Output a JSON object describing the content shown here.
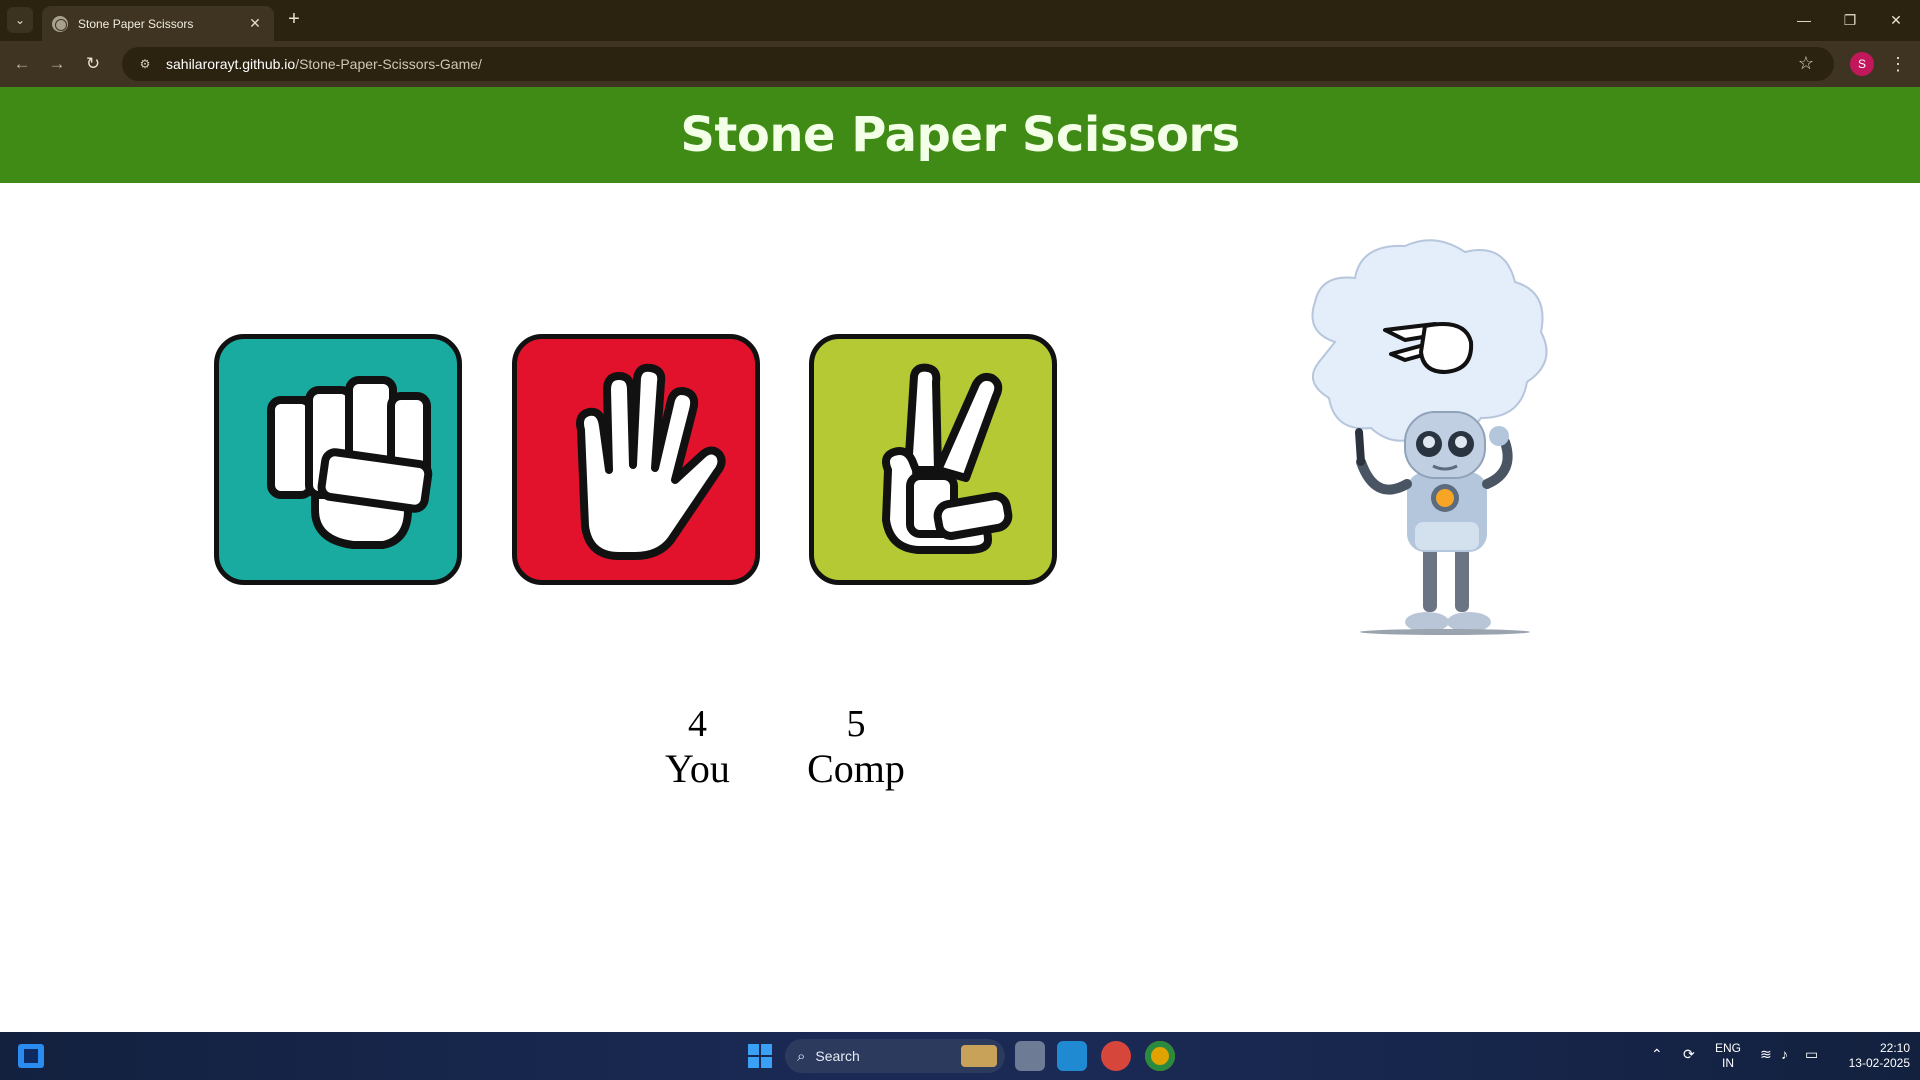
{
  "browser": {
    "tab_title": "Stone Paper Scissors",
    "new_tab_label": "+",
    "url_host": "sahilarorayt.github.io",
    "url_path": "/Stone-Paper-Scissors-Game/",
    "profile_initial": "S"
  },
  "page": {
    "title": "Stone Paper Scissors",
    "choices": [
      {
        "id": "rock",
        "color": "#1aaba0"
      },
      {
        "id": "paper",
        "color": "#e2122c"
      },
      {
        "id": "scissors",
        "color": "#b4c934"
      }
    ],
    "computer_choice_icon": "scissors-hand-icon",
    "score": {
      "user_score": "4",
      "user_label": "You",
      "comp_score": "5",
      "comp_label": "Comp"
    },
    "header_color": "#3f8b15"
  },
  "taskbar": {
    "search_label": "Search",
    "lang_top": "ENG",
    "lang_bottom": "IN",
    "time": "22:10",
    "date": "13-02-2025"
  }
}
